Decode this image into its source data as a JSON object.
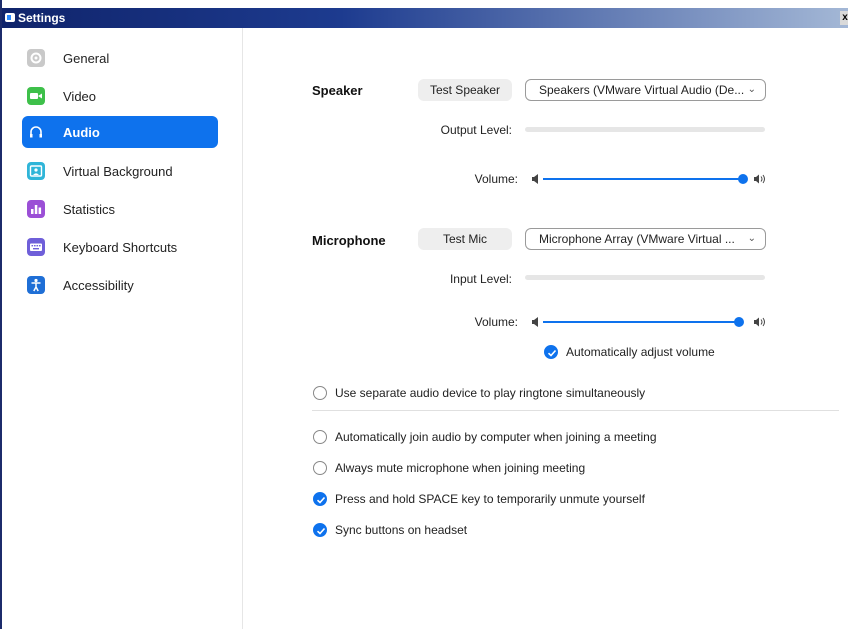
{
  "window": {
    "title": "Settings",
    "close_label": "x"
  },
  "sidebar": {
    "items": [
      {
        "label": "General",
        "icon": "gear-icon",
        "color": "#c9c9c9"
      },
      {
        "label": "Video",
        "icon": "video-camera-icon",
        "color": "#3ec04a"
      },
      {
        "label": "Audio",
        "icon": "headphones-icon",
        "color": "#0e72ed",
        "active": true
      },
      {
        "label": "Virtual Background",
        "icon": "virtual-background-icon",
        "color": "#2fb5d8"
      },
      {
        "label": "Statistics",
        "icon": "bar-chart-icon",
        "color": "#9b4fd6"
      },
      {
        "label": "Keyboard Shortcuts",
        "icon": "keyboard-icon",
        "color": "#6f5fd9"
      },
      {
        "label": "Accessibility",
        "icon": "accessibility-person-icon",
        "color": "#1f6fd6"
      }
    ]
  },
  "speaker": {
    "section_label": "Speaker",
    "test_button": "Test Speaker",
    "device": "Speakers (VMware Virtual Audio (De...",
    "output_level_label": "Output Level:",
    "volume_label": "Volume:",
    "volume": 1.0
  },
  "microphone": {
    "section_label": "Microphone",
    "test_button": "Test Mic",
    "device": "Microphone Array (VMware Virtual ...",
    "input_level_label": "Input Level:",
    "volume_label": "Volume:",
    "volume": 0.98,
    "auto_adjust_label": "Automatically adjust volume",
    "auto_adjust_checked": true
  },
  "options": [
    {
      "label": "Use separate audio device to play ringtone simultaneously",
      "checked": false
    },
    {
      "label": "Automatically join audio by computer when joining a meeting",
      "checked": false
    },
    {
      "label": "Always mute microphone when joining meeting",
      "checked": false
    },
    {
      "label": "Press and hold SPACE key to temporarily unmute yourself",
      "checked": true
    },
    {
      "label": "Sync buttons on headset",
      "checked": true
    }
  ],
  "accent_color": "#0e72ed"
}
